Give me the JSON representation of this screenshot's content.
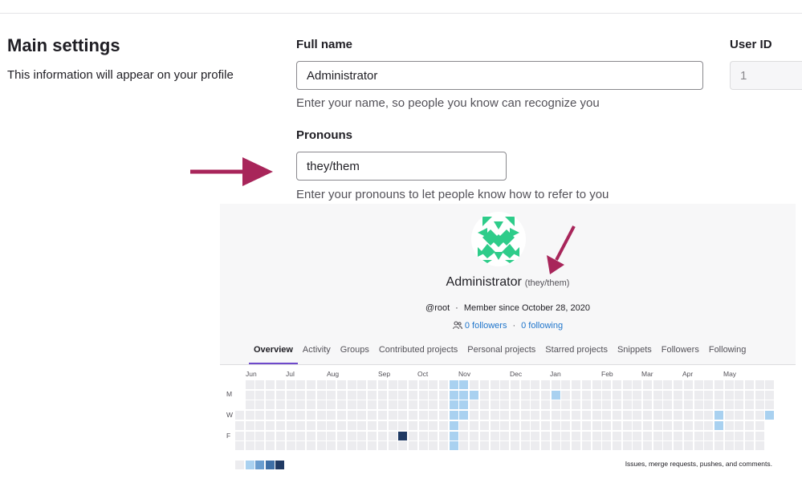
{
  "settings": {
    "title": "Main settings",
    "description": "This information will appear on your profile",
    "full_name": {
      "label": "Full name",
      "value": "Administrator",
      "help": "Enter your name, so people you know can recognize you"
    },
    "user_id": {
      "label": "User ID",
      "value": "1"
    },
    "pronouns": {
      "label": "Pronouns",
      "value": "they/them",
      "help": "Enter your pronouns to let people know how to refer to you"
    }
  },
  "colors": {
    "arrow": "#a8255a",
    "accent": "#6e49cb",
    "link": "#1f75cb",
    "avatar_green": "#2ecc8a"
  },
  "profile": {
    "name": "Administrator",
    "pronouns": "(they/them)",
    "username": "@root",
    "member_since": "Member since October 28, 2020",
    "followers": "0 followers",
    "following": "0 following",
    "separator": "·",
    "tabs": [
      "Overview",
      "Activity",
      "Groups",
      "Contributed projects",
      "Personal projects",
      "Starred projects",
      "Snippets",
      "Followers",
      "Following"
    ],
    "active_tab": "Overview"
  },
  "contributions": {
    "months": [
      "Jun",
      "Jul",
      "Aug",
      "Sep",
      "Oct",
      "Nov",
      "Dec",
      "Jan",
      "Feb",
      "Mar",
      "Apr",
      "May"
    ],
    "day_labels": [
      "M",
      "W",
      "F"
    ],
    "note": "Issues, merge requests, pushes, and comments.",
    "level_colors": [
      "#ececef",
      "#a9d1f0",
      "#6a9ed0",
      "#3e6fa6",
      "#203a63"
    ]
  }
}
